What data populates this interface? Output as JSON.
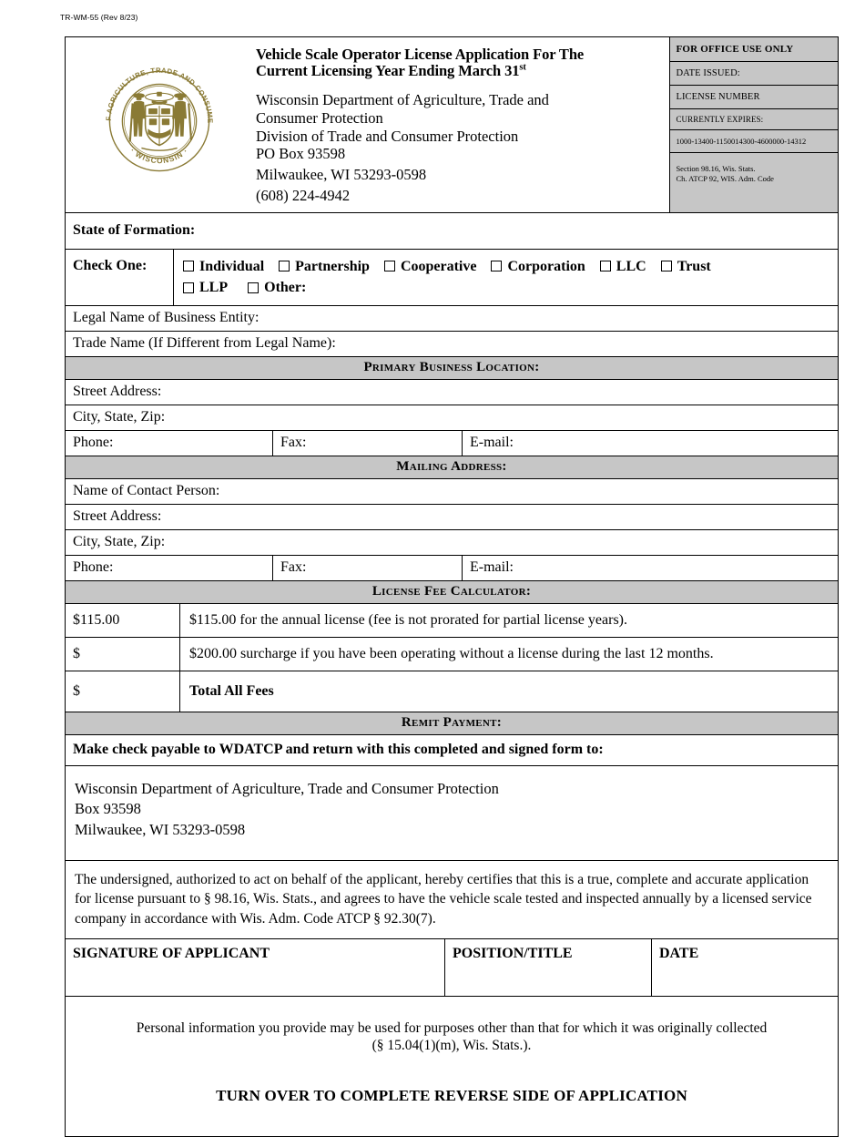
{
  "form_number": "TR-WM-55 (Rev 8/23)",
  "header": {
    "seal_outer_text": "DEPARTMENT OF AGRICULTURE, TRADE AND CONSUMER PROTECTION",
    "seal_bottom_text": "WISCONSIN",
    "seal_color": "#8a7a35",
    "title_line1": "Vehicle Scale Operator License Application For The",
    "title_line2": "Current Licensing Year Ending March 31",
    "title_superscript": "st",
    "agency_line1": "Wisconsin Department of Agriculture, Trade and",
    "agency_line2": "Consumer Protection",
    "agency_line3": "Division of Trade and Consumer Protection",
    "agency_line4": "PO Box 93598",
    "agency_line5": "Milwaukee, WI  53293-0598",
    "agency_phone": "(608) 224-4942"
  },
  "office_use": {
    "title": "FOR OFFICE USE ONLY",
    "date_issued": "DATE ISSUED:",
    "license_number": "LICENSE NUMBER",
    "currently_expires": "CURRENTLY EXPIRES:",
    "account_code": "1000-13400-1150014300-4600000-14312",
    "citation_line1": "Section 98.16, Wis. Stats.",
    "citation_line2": "Ch. ATCP 92, WIS. Adm. Code",
    "background_color": "#c6c6c6"
  },
  "state_of_formation_label": "State of Formation:",
  "check_one": {
    "label": "Check One:",
    "options_row1": [
      "Individual",
      "Partnership",
      "Cooperative",
      "Corporation",
      "LLC",
      "Trust"
    ],
    "options_row2": [
      "LLP",
      "Other:"
    ]
  },
  "legal_name_label": "Legal Name of Business Entity:",
  "trade_name_label": "Trade Name  (If Different from Legal Name):",
  "primary_business": {
    "heading": "Primary Business Location:",
    "street_label": "Street Address:",
    "city_label": "City, State, Zip:",
    "phone_label": "Phone:",
    "fax_label": "Fax:",
    "email_label": "E-mail:"
  },
  "mailing_address": {
    "heading": "Mailing Address:",
    "contact_label": "Name of Contact Person:",
    "street_label": "Street Address:",
    "city_label": "City, State, Zip:",
    "phone_label": "Phone:",
    "fax_label": "Fax:",
    "email_label": "E-mail:"
  },
  "fee_calculator": {
    "heading": "License Fee Calculator:",
    "rows": [
      {
        "amount": "$115.00",
        "description": "$115.00 for the annual license (fee is not prorated for partial license years)."
      },
      {
        "amount": "$",
        "description": "$200.00 surcharge if you have been operating without a license during the last 12 months."
      },
      {
        "amount": "$",
        "description": "Total All Fees"
      }
    ]
  },
  "remit": {
    "heading": "Remit Payment:",
    "instruction": "Make check payable to WDATCP and return with this completed and signed form to:",
    "address_line1": "Wisconsin Department of Agriculture, Trade and Consumer Protection",
    "address_line2": "Box 93598",
    "address_line3": "Milwaukee, WI  53293-0598"
  },
  "certification": "The undersigned, authorized to act on behalf of the applicant, hereby certifies that this is a true, complete and accurate application for license pursuant to § 98.16, Wis. Stats., and agrees to have the vehicle scale tested and inspected annually by a licensed service company in accordance with Wis. Adm. Code ATCP § 92.30(7).",
  "signature_row": {
    "signature_label": "SIGNATURE OF APPLICANT",
    "position_label": "POSITION/TITLE",
    "date_label": "DATE"
  },
  "footer": {
    "notice_line1": "Personal information you provide may be used for purposes other than that for which it was originally collected",
    "notice_line2": "(§ 15.04(1)(m), Wis. Stats.).",
    "turn_over": "TURN OVER TO COMPLETE REVERSE SIDE OF APPLICATION"
  }
}
